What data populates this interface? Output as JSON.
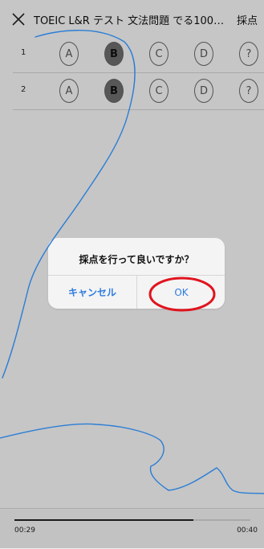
{
  "header": {
    "title": "TOEIC L&R テスト 文法問題 でる1000問…",
    "grade_label": "採点"
  },
  "rows": [
    {
      "num": "1",
      "choices": [
        "A",
        "B",
        "C",
        "D",
        "?"
      ],
      "selected": 1
    },
    {
      "num": "2",
      "choices": [
        "A",
        "B",
        "C",
        "D",
        "?"
      ],
      "selected": 1
    }
  ],
  "dialog": {
    "message": "採点を行って良いですか？",
    "cancel": "キャンセル",
    "ok": "OK"
  },
  "player": {
    "elapsed": "00:29",
    "total": "00:40",
    "progress": 0.76
  },
  "colors": {
    "accent": "#2f7be0",
    "annotation_red": "#e0141e",
    "annotation_blue": "#2a7dd6"
  }
}
